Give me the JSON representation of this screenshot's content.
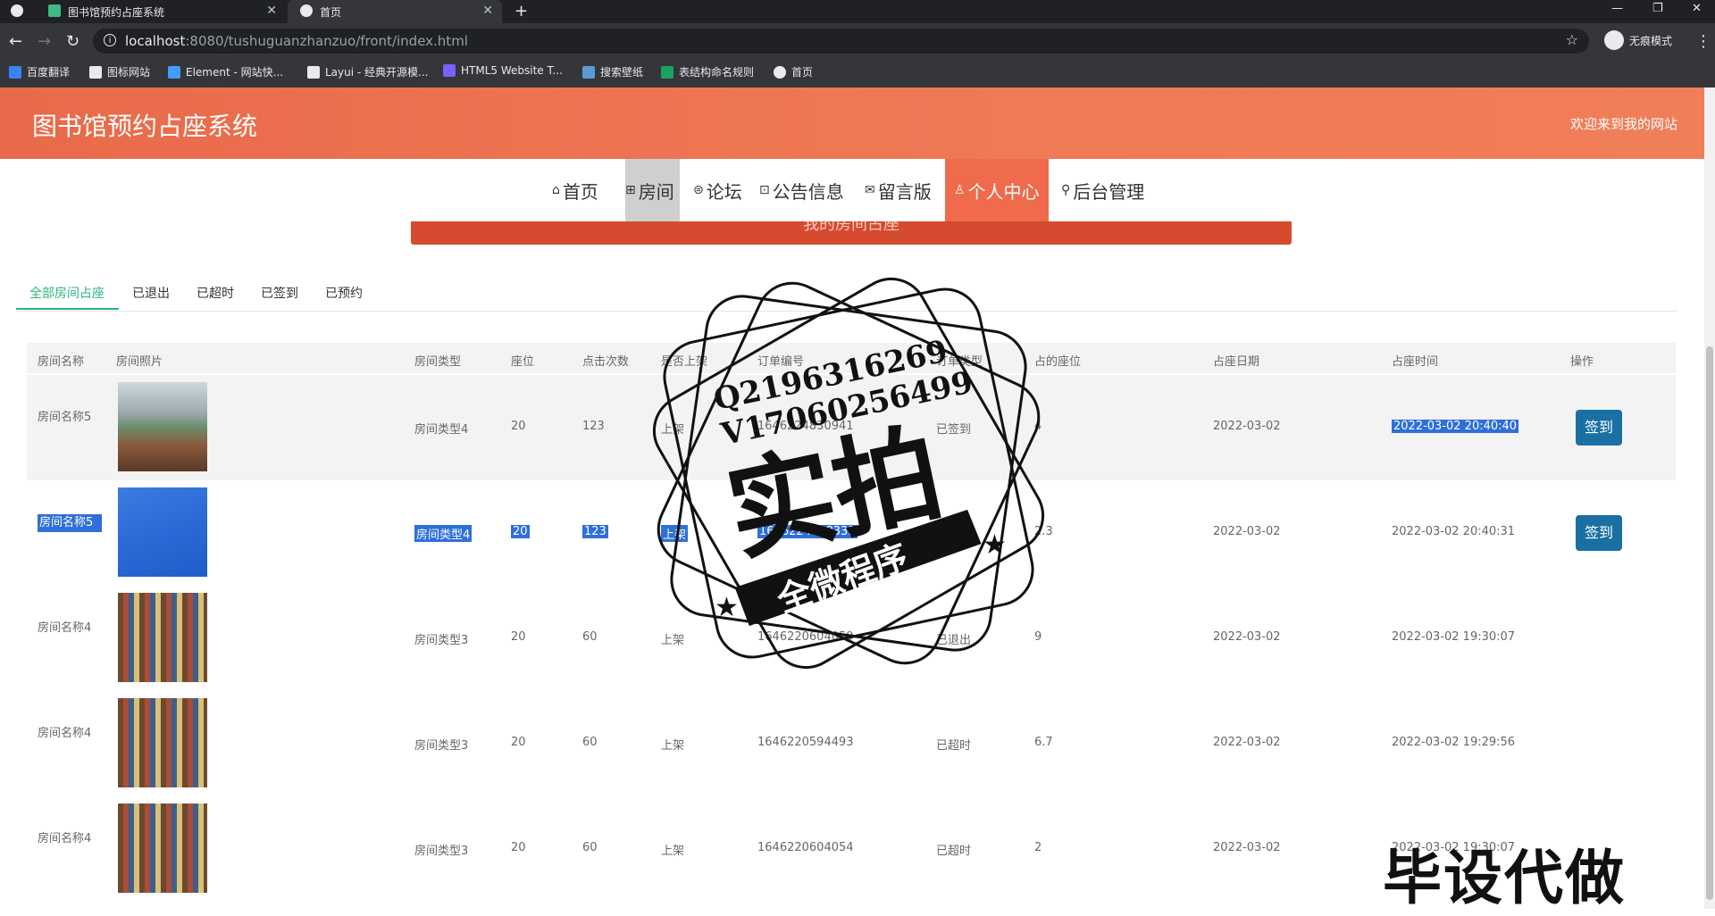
{
  "browser": {
    "tabs": [
      {
        "title": "图书馆预约占座系统"
      },
      {
        "title": "首页"
      }
    ],
    "url_host": "localhost",
    "url_rest": ":8080/tushuguanzhanzuo/front/index.html",
    "incognito": "无痕模式",
    "bookmarks": [
      "百度翻译",
      "图标网站",
      "Element - 网站快...",
      "Layui - 经典开源模...",
      "HTML5 Website T...",
      "搜索壁纸",
      "表结构命名规则",
      "首页"
    ]
  },
  "header": {
    "site_title": "图书馆预约占座系统",
    "welcome": "欢迎来到我的网站"
  },
  "nav": [
    {
      "icon": "⌂",
      "label": "首页"
    },
    {
      "icon": "⊞",
      "label": "房间"
    },
    {
      "icon": "⊜",
      "label": "论坛"
    },
    {
      "icon": "⊡",
      "label": "公告信息"
    },
    {
      "icon": "✉",
      "label": "留言版"
    },
    {
      "icon": "♙",
      "label": "个人中心"
    },
    {
      "icon": "⚲",
      "label": "后台管理"
    }
  ],
  "banner_text": "我的房间占座",
  "page_tabs": [
    "全部房间占座",
    "已退出",
    "已超时",
    "已签到",
    "已预约"
  ],
  "table": {
    "headers": [
      "房间名称",
      "房间照片",
      "房间类型",
      "座位",
      "点击次数",
      "是否上架",
      "订单编号",
      "订单类型",
      "占的座位",
      "占座日期",
      "占座时间",
      "操作"
    ],
    "rows": [
      {
        "name": "房间名称5",
        "type": "房间类型4",
        "seats": "20",
        "clicks": "123",
        "shelf": "上架",
        "order_no": "1646224830941",
        "order_type": "已签到",
        "seat": "4",
        "date": "2022-03-02",
        "time": "2022-03-02 20:40:40",
        "action": "签到"
      },
      {
        "name": "房间名称5",
        "type": "房间类型4",
        "seats": "20",
        "clicks": "123",
        "shelf": "上架",
        "order_no": "1646224828331",
        "order_type": "已预约",
        "seat": "2.3",
        "date": "2022-03-02",
        "time": "2022-03-02 20:40:31",
        "action": "签到"
      },
      {
        "name": "房间名称4",
        "type": "房间类型3",
        "seats": "20",
        "clicks": "60",
        "shelf": "上架",
        "order_no": "1646220604059",
        "order_type": "已退出",
        "seat": "9",
        "date": "2022-03-02",
        "time": "2022-03-02 19:30:07",
        "action": ""
      },
      {
        "name": "房间名称4",
        "type": "房间类型3",
        "seats": "20",
        "clicks": "60",
        "shelf": "上架",
        "order_no": "1646220594493",
        "order_type": "已超时",
        "seat": "6.7",
        "date": "2022-03-02",
        "time": "2022-03-02 19:29:56",
        "action": ""
      },
      {
        "name": "房间名称4",
        "type": "房间类型3",
        "seats": "20",
        "clicks": "60",
        "shelf": "上架",
        "order_no": "1646220604054",
        "order_type": "已超时",
        "seat": "2",
        "date": "2022-03-02",
        "time": "2022-03-02 19:30:07",
        "action": ""
      }
    ]
  },
  "watermark": {
    "line1": "Q2196316269",
    "line2": "V17060256499",
    "big": "实拍",
    "ribbon": "全微程序",
    "corner": "毕设代做"
  },
  "colors": {
    "accent": "#2eb47d",
    "header": "#ef6b4c",
    "button": "#1a6fa3",
    "selection": "#2f6fd9"
  }
}
